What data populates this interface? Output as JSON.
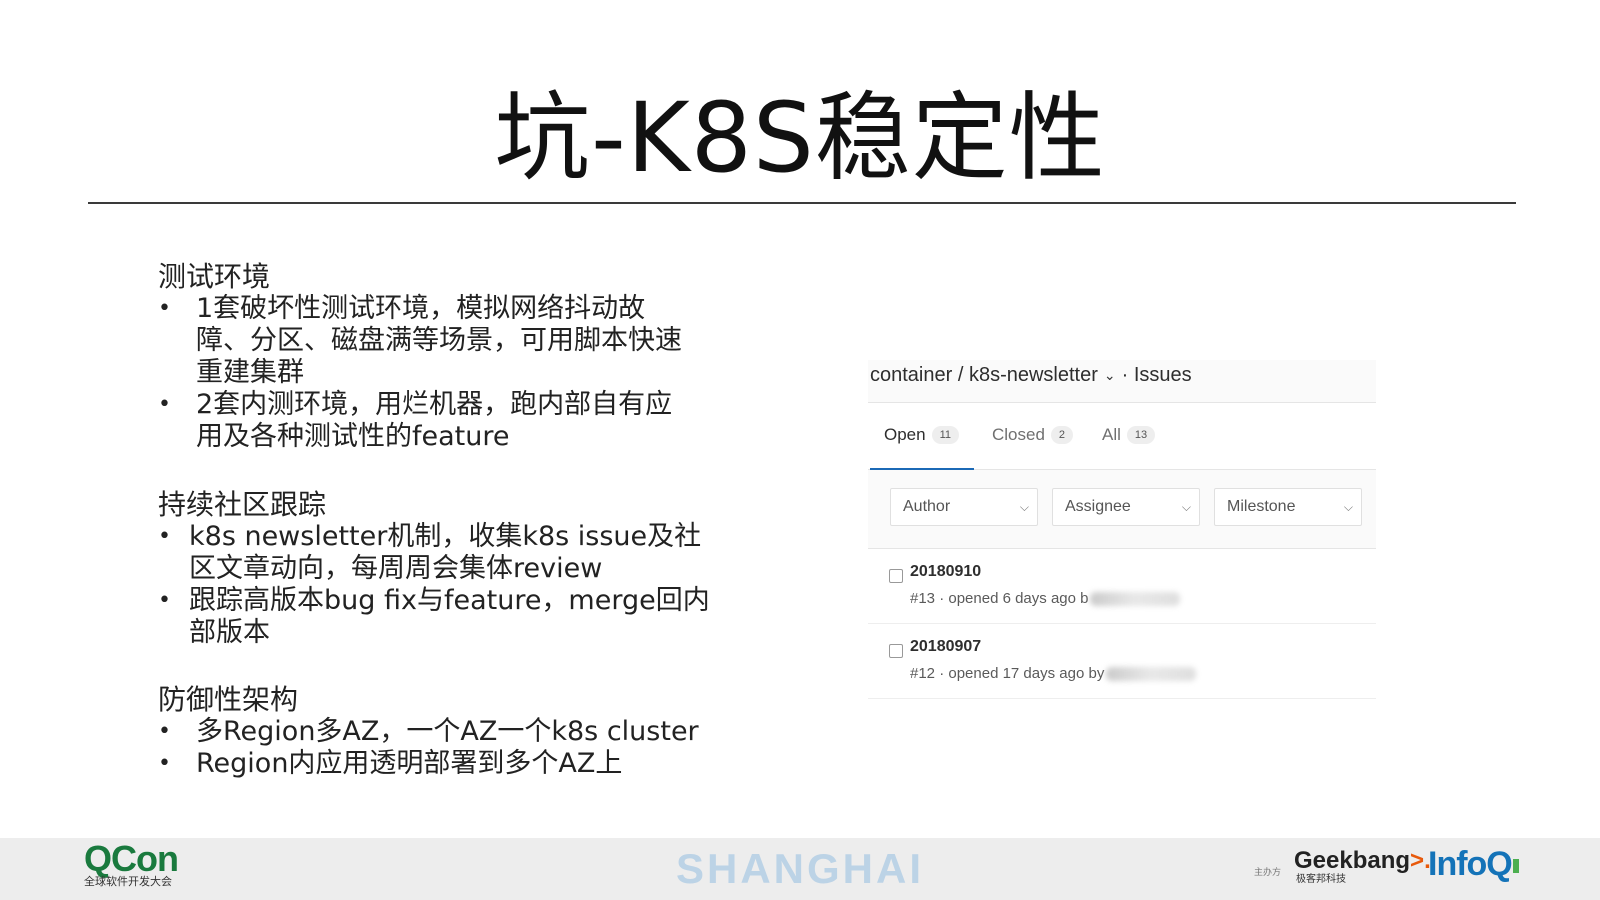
{
  "slide_title": "坑-K8S稳定性",
  "sections": [
    {
      "heading": "测试环境",
      "bullets": [
        [
          "1套破坏性测试环境，模拟网络抖动故",
          "障、分区、磁盘满等场景，可用脚本快速",
          "重建集群"
        ],
        [
          "2套内测环境，用烂机器，跑内部自有应",
          "用及各种测试性的feature"
        ]
      ]
    },
    {
      "heading": "持续社区跟踪",
      "bullets": [
        [
          "k8s newsletter机制，收集k8s issue及社",
          "区文章动向，每周周会集体review"
        ],
        [
          "跟踪高版本bug fix与feature，merge回内",
          "部版本"
        ]
      ]
    },
    {
      "heading": "防御性架构",
      "bullets": [
        [
          "多Region多AZ，一个AZ一个k8s cluster"
        ],
        [
          "Region内应用透明部署到多个AZ上"
        ]
      ]
    }
  ],
  "bullet_char": "•",
  "issues_panel": {
    "breadcrumb": {
      "project": "container / k8s-newsletter",
      "chevron": "⌄",
      "suffix": "· Issues"
    },
    "tabs": [
      {
        "label": "Open",
        "count": "11",
        "active": true
      },
      {
        "label": "Closed",
        "count": "2",
        "active": false
      },
      {
        "label": "All",
        "count": "13",
        "active": false
      }
    ],
    "filters": [
      {
        "label": "Author",
        "caret": "⌵"
      },
      {
        "label": "Assignee",
        "caret": "⌵"
      },
      {
        "label": "Milestone",
        "caret": "⌵"
      }
    ],
    "issues": [
      {
        "title": "20180910",
        "meta": "#13 · opened 6 days ago b"
      },
      {
        "title": "20180907",
        "meta": "#12 · opened 17 days ago by"
      }
    ]
  },
  "footer": {
    "qcon_mark": "QCon",
    "qcon_sub": "全球软件开发大会",
    "city": "SHANGHAI",
    "organizer_label": "主办方",
    "geekbang": "Geekbang",
    "geekbang_arrow": ">.",
    "geekbang_sub": "极客邦科技",
    "infoq": "InfoQ"
  },
  "colors": {
    "tab_underline": "#1b69b6",
    "qcon_green": "#1a7a3e",
    "city_blue": "#bcd3e6",
    "infoq_blue": "#1473b8",
    "geek_orange": "#e85a0c"
  }
}
